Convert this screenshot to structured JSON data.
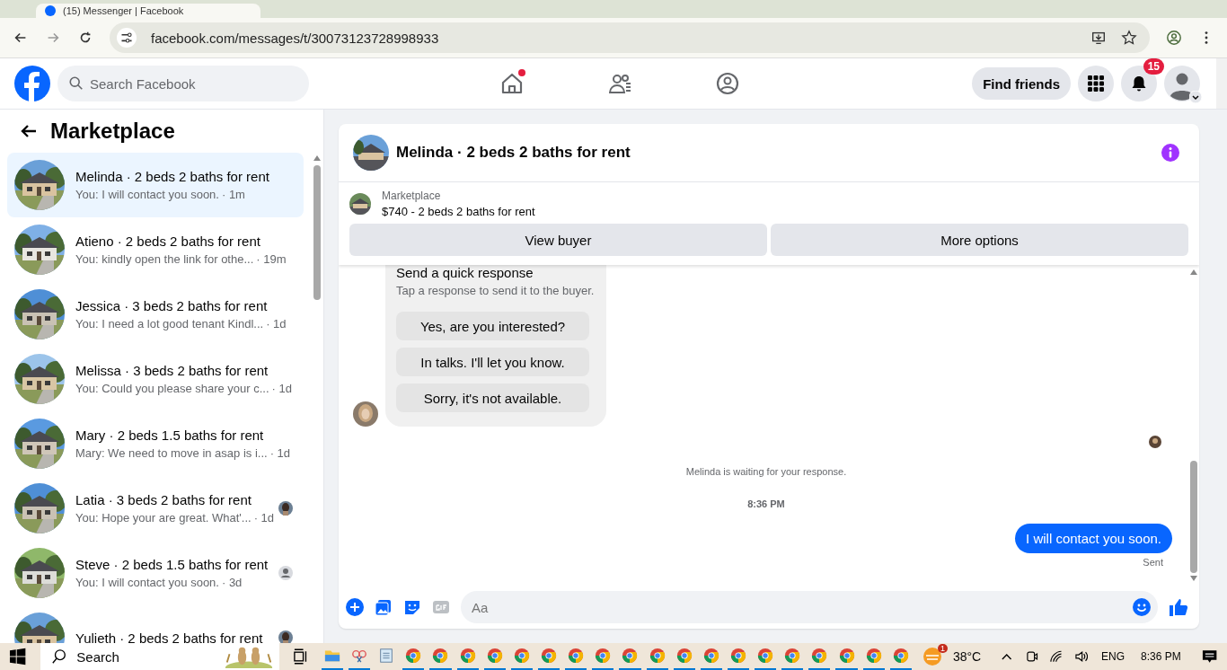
{
  "browser": {
    "tab_title": "(15) Messenger | Facebook",
    "url": "facebook.com/messages/t/30073123728998933"
  },
  "header": {
    "search_placeholder": "Search Facebook",
    "nav": [
      {
        "kind": "home",
        "dot": true
      },
      {
        "kind": "friends",
        "dot": false
      },
      {
        "kind": "groups",
        "dot": false
      }
    ],
    "find_friends": "Find friends",
    "notifications_count": "15"
  },
  "sidebar": {
    "title": "Marketplace",
    "conversations": [
      {
        "name": "Melinda · 2 beds 2 baths for rent",
        "snippet": "You: I will contact you soon.",
        "time": "· 1m",
        "selected": true
      },
      {
        "name": "Atieno · 2 beds 2 baths for rent",
        "snippet": "You: kindly open the link for othe...",
        "time": "· 19m",
        "selected": false
      },
      {
        "name": "Jessica · 3 beds 2 baths for rent",
        "snippet": "You: I need a lot good tenant Kindl...",
        "time": "· 1d",
        "selected": false
      },
      {
        "name": "Melissa · 3 beds 2 baths for rent",
        "snippet": "You: Could you please share your c...",
        "time": "· 1d",
        "selected": false
      },
      {
        "name": "Mary · 2 beds 1.5 baths for rent",
        "snippet": "Mary: We need to move in asap is i...",
        "time": "· 1d",
        "selected": false
      },
      {
        "name": "Latia · 3 beds 2 baths for rent",
        "snippet": "You: Hope your are great. What'...",
        "time": "· 1d",
        "selected": false
      },
      {
        "name": "Steve · 2 beds 1.5 baths for rent",
        "snippet": "You: I will contact you soon.",
        "time": "· 3d",
        "selected": false,
        "seen_by": {
          "kind": "default"
        }
      },
      {
        "name": "Yulieth · 2 beds 2 baths for rent",
        "selected": false
      }
    ]
  },
  "chat": {
    "title": "Melinda · 2 beds 2 baths for rent",
    "listing": {
      "label": "Marketplace",
      "title": "$740 - 2 beds 2 baths for rent"
    },
    "buttons": [
      "View buyer",
      "More options"
    ],
    "quick_response": {
      "title": "Send a quick response",
      "subtitle": "Tap a response to send it to the buyer.",
      "options": [
        "Yes, are you interested?",
        "In talks. I'll let you know.",
        "Sorry, it's not available."
      ]
    },
    "status": "Melinda is waiting for your response.",
    "timestamp": "8:36 PM",
    "outgoing": "I will contact you soon.",
    "delivery": "Sent",
    "composer_placeholder": "Aa"
  },
  "taskbar": {
    "search": "Search",
    "apps": [
      {
        "kind": "explorer",
        "active": true
      },
      {
        "kind": "snip",
        "active": true
      },
      {
        "kind": "notepad",
        "active": false
      },
      {
        "kind": "chrome",
        "active": true
      },
      {
        "kind": "chrome",
        "active": true
      },
      {
        "kind": "chrome",
        "active": true
      },
      {
        "kind": "chrome",
        "active": true
      },
      {
        "kind": "chrome",
        "active": true
      },
      {
        "kind": "chrome",
        "active": true
      },
      {
        "kind": "chrome",
        "active": true
      },
      {
        "kind": "chrome",
        "active": true
      },
      {
        "kind": "chrome",
        "active": true
      },
      {
        "kind": "chrome",
        "active": true
      },
      {
        "kind": "chrome",
        "active": true
      },
      {
        "kind": "chrome",
        "active": true
      },
      {
        "kind": "chrome",
        "active": true
      },
      {
        "kind": "chrome",
        "active": true
      },
      {
        "kind": "chrome",
        "active": true
      },
      {
        "kind": "chrome",
        "active": true
      },
      {
        "kind": "chrome",
        "active": true
      },
      {
        "kind": "chrome",
        "active": true
      },
      {
        "kind": "chrome",
        "active": true
      }
    ],
    "weather_badge": "1",
    "temperature": "38°C",
    "language": "ENG",
    "clock": "8:36 PM"
  }
}
